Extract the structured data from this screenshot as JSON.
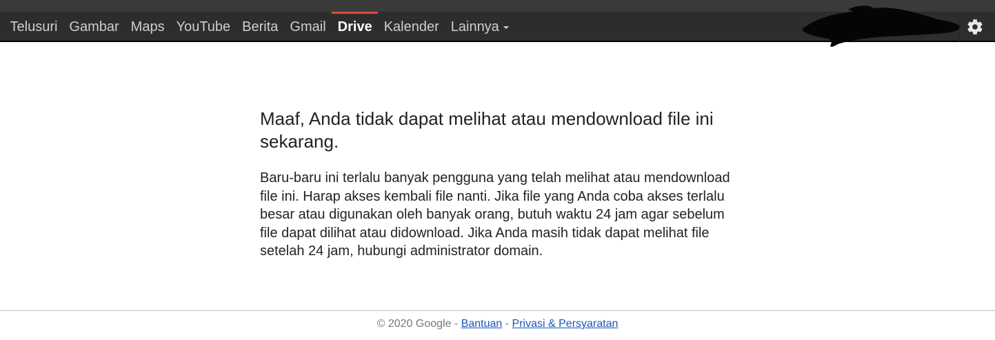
{
  "nav": {
    "items": [
      {
        "label": "Telusuri",
        "active": false
      },
      {
        "label": "Gambar",
        "active": false
      },
      {
        "label": "Maps",
        "active": false
      },
      {
        "label": "YouTube",
        "active": false
      },
      {
        "label": "Berita",
        "active": false
      },
      {
        "label": "Gmail",
        "active": false
      },
      {
        "label": "Drive",
        "active": true
      },
      {
        "label": "Kalender",
        "active": false
      }
    ],
    "more_label": "Lainnya"
  },
  "icons": {
    "settings": "gear-icon",
    "more": "caret-down-icon"
  },
  "main": {
    "heading": "Maaf, Anda tidak dapat melihat atau mendownload file ini sekarang.",
    "message": "Baru-baru ini terlalu banyak pengguna yang telah melihat atau mendownload file ini. Harap akses kembali file nanti. Jika file yang Anda coba akses terlalu besar atau digunakan oleh banyak orang, butuh waktu 24 jam agar sebelum file dapat dilihat atau didownload. Jika Anda masih tidak dapat melihat file setelah 24 jam, hubungi administrator domain."
  },
  "footer": {
    "copyright": "© 2020 Google",
    "separator": "-",
    "help_link": "Bantuan",
    "privacy_link": "Privasi & Persyaratan"
  },
  "colors": {
    "topbar": "#2d2d2d",
    "active_indicator": "#dd4b39",
    "link": "#1a56b8"
  }
}
